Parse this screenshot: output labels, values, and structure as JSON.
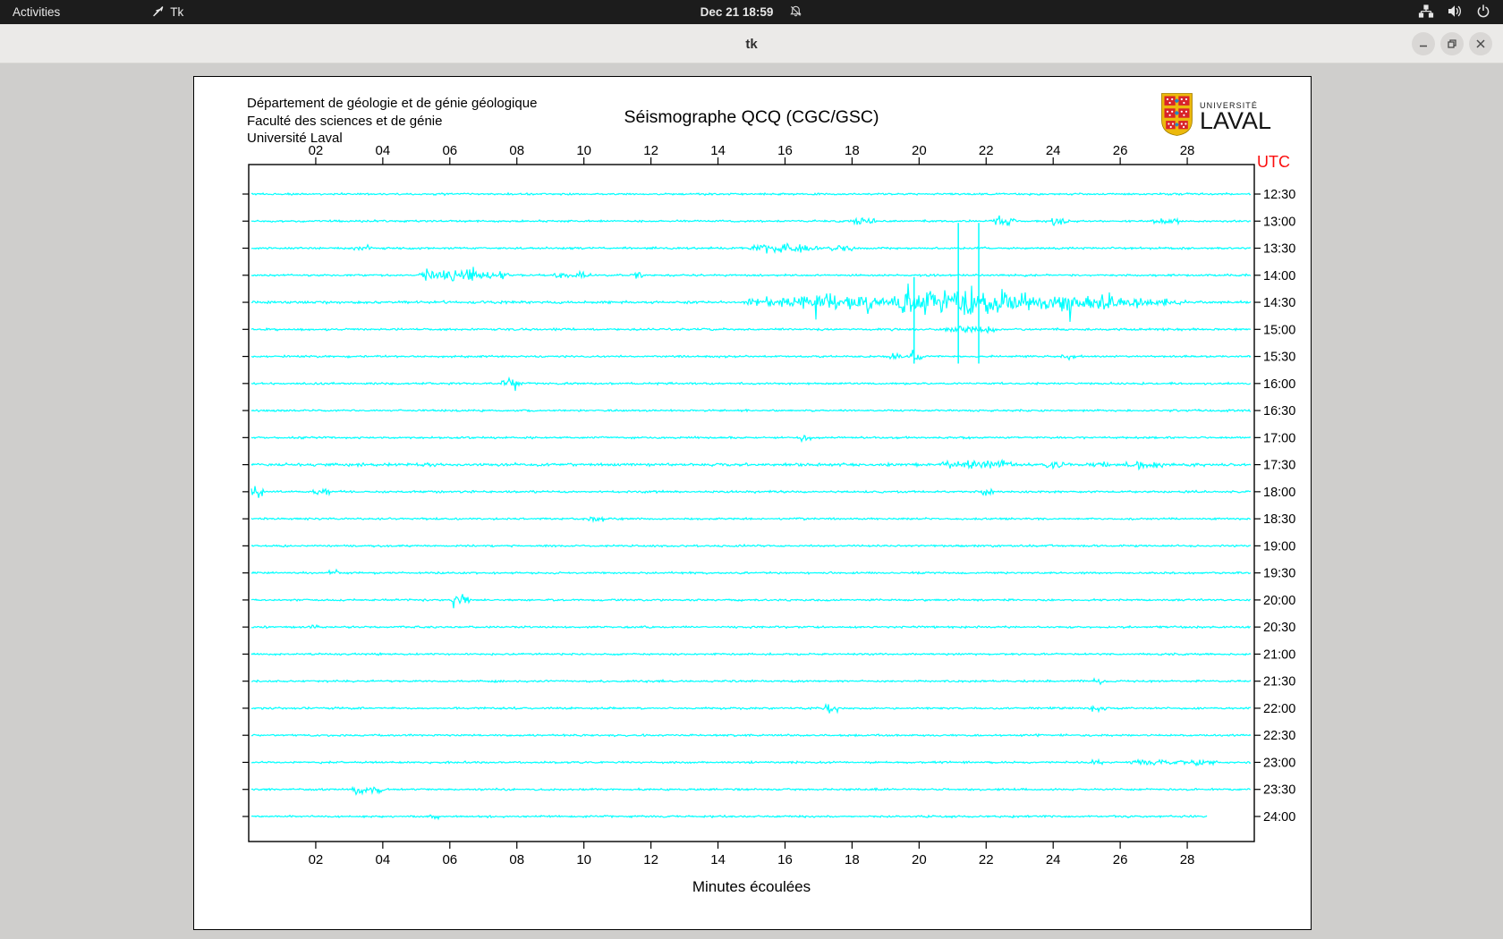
{
  "topbar": {
    "activities": "Activities",
    "app": "Tk",
    "clock": "Dec 21  18:59"
  },
  "titlebar": {
    "title": "tk"
  },
  "canvas_header": {
    "line1": "Département de géologie et de génie géologique",
    "line2": "Faculté des sciences et de génie",
    "line3": "Université Laval"
  },
  "logo": {
    "top": "UNIVERSITÉ",
    "bottom": "LAVAL"
  },
  "chart_data": {
    "type": "line",
    "subtype": "seismogram-helicorder",
    "title": "Séismographe QCQ (CGC/GSC)",
    "xlabel": "Minutes écoulées",
    "right_axis_label": "UTC",
    "x_range_minutes": [
      0,
      30
    ],
    "x_ticks": [
      "02",
      "04",
      "06",
      "08",
      "10",
      "12",
      "14",
      "16",
      "18",
      "20",
      "22",
      "24",
      "26",
      "28"
    ],
    "trace_color": "#00ffff",
    "axis_color": "#000000",
    "utc_label_color": "#fb0d0d",
    "rows": [
      {
        "utc": "12:30",
        "base": 1.0,
        "events": []
      },
      {
        "utc": "13:00",
        "base": 1.0,
        "events": [
          [
            18.1,
            18.6,
            3.5
          ],
          [
            22.3,
            22.8,
            4.5
          ],
          [
            24.0,
            24.4,
            3.5
          ],
          [
            27.0,
            27.7,
            3.0
          ]
        ]
      },
      {
        "utc": "13:30",
        "base": 1.0,
        "events": [
          [
            3.2,
            3.6,
            2.5
          ],
          [
            15.2,
            16.8,
            4.0
          ],
          [
            17.4,
            18.0,
            2.5
          ]
        ]
      },
      {
        "utc": "14:00",
        "base": 1.0,
        "events": [
          [
            5.2,
            6.6,
            6.0
          ],
          [
            6.6,
            7.7,
            3.5
          ],
          [
            9.2,
            10.1,
            3.0
          ],
          [
            11.45,
            11.7,
            4.0
          ]
        ]
      },
      {
        "utc": "14:30",
        "base": 1.3,
        "events": [
          [
            15.0,
            16.5,
            3.5
          ],
          [
            16.5,
            18.5,
            7.0
          ],
          [
            18.5,
            19.5,
            5.5
          ],
          [
            19.5,
            21.5,
            14.0
          ],
          [
            21.5,
            22.5,
            9.0
          ],
          [
            22.5,
            24.0,
            6.5
          ],
          [
            24.0,
            25.6,
            7.5
          ],
          [
            25.6,
            26.5,
            4.5
          ],
          [
            26.5,
            27.8,
            2.5
          ]
        ]
      },
      {
        "utc": "15:00",
        "base": 1.1,
        "events": [
          [
            20.8,
            22.2,
            2.2
          ]
        ]
      },
      {
        "utc": "15:30",
        "base": 1.0,
        "events": [
          [
            19.2,
            19.45,
            3.5
          ],
          [
            19.8,
            20.05,
            3.5
          ],
          [
            24.3,
            24.6,
            2.5
          ]
        ]
      },
      {
        "utc": "16:00",
        "base": 1.0,
        "events": [
          [
            7.6,
            8.05,
            3.5
          ]
        ]
      },
      {
        "utc": "16:30",
        "base": 1.0,
        "events": []
      },
      {
        "utc": "17:00",
        "base": 1.0,
        "events": [
          [
            16.5,
            16.75,
            2.5
          ]
        ]
      },
      {
        "utc": "17:30",
        "base": 1.5,
        "events": [
          [
            20.8,
            22.6,
            2.8
          ],
          [
            23.8,
            24.3,
            2.8
          ],
          [
            25.2,
            25.6,
            2.5
          ],
          [
            26.3,
            27.2,
            3.0
          ]
        ]
      },
      {
        "utc": "18:00",
        "base": 1.1,
        "events": [
          [
            0.05,
            0.4,
            5.0
          ],
          [
            2.0,
            2.35,
            3.0
          ],
          [
            21.9,
            22.25,
            3.0
          ]
        ]
      },
      {
        "utc": "18:30",
        "base": 1.0,
        "events": [
          [
            10.2,
            10.55,
            2.5
          ]
        ]
      },
      {
        "utc": "19:00",
        "base": 1.0,
        "events": []
      },
      {
        "utc": "19:30",
        "base": 1.0,
        "events": [
          [
            2.4,
            2.65,
            2.5
          ]
        ]
      },
      {
        "utc": "20:00",
        "base": 1.0,
        "events": [
          [
            6.1,
            6.55,
            3.5
          ]
        ]
      },
      {
        "utc": "20:30",
        "base": 1.0,
        "events": [
          [
            1.9,
            2.15,
            2.5
          ]
        ]
      },
      {
        "utc": "21:00",
        "base": 1.0,
        "events": []
      },
      {
        "utc": "21:30",
        "base": 1.0,
        "events": [
          [
            25.2,
            25.45,
            2.5
          ]
        ]
      },
      {
        "utc": "22:00",
        "base": 1.0,
        "events": [
          [
            17.2,
            17.55,
            3.5
          ],
          [
            25.2,
            25.55,
            3.0
          ]
        ]
      },
      {
        "utc": "22:30",
        "base": 1.0,
        "events": []
      },
      {
        "utc": "23:00",
        "base": 1.0,
        "events": [
          [
            25.2,
            25.55,
            3.0
          ],
          [
            26.5,
            28.6,
            2.2
          ]
        ]
      },
      {
        "utc": "23:30",
        "base": 1.0,
        "events": [
          [
            3.2,
            3.9,
            3.5
          ]
        ]
      },
      {
        "utc": "24:00",
        "base": 1.0,
        "end_minute": 28.6,
        "events": [
          [
            5.4,
            5.65,
            2.5
          ]
        ]
      }
    ],
    "clip_spikes": [
      {
        "minute": 19.85,
        "from_row": 3,
        "to_row": 6
      },
      {
        "minute": 21.17,
        "from_row": 1,
        "to_row": 6
      },
      {
        "minute": 21.78,
        "from_row": 1,
        "to_row": 6
      }
    ]
  }
}
